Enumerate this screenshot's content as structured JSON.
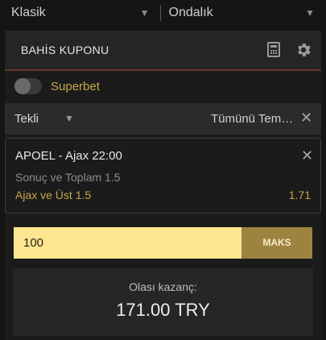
{
  "top": {
    "odds_format_select": "Klasik",
    "odds_display_select": "Ondalık"
  },
  "coupon": {
    "title": "BAHİS KUPONU",
    "superbet_label": "Superbet",
    "superbet_enabled": false,
    "bet_type": "Tekli",
    "clear_all_label": "Tümünü Tem…"
  },
  "bet": {
    "event": "APOEL - Ajax 22:00",
    "market": "Sonuç ve Toplam 1.5",
    "selection": "Ajax ve Üst 1.5",
    "odds": "1.71"
  },
  "stake": {
    "value": "100",
    "max_label": "MAKS"
  },
  "winnings": {
    "label": "Olası kazanç:",
    "amount": "171.00 TRY"
  },
  "colors": {
    "accent_gold": "#c9a64a",
    "stake_bg": "#fde68f",
    "max_button": "#9e8340",
    "header_underline": "#6b3432"
  },
  "icons": [
    "chevron-down-icon",
    "calculator-icon",
    "gear-icon",
    "close-icon",
    "toggle-switch"
  ]
}
